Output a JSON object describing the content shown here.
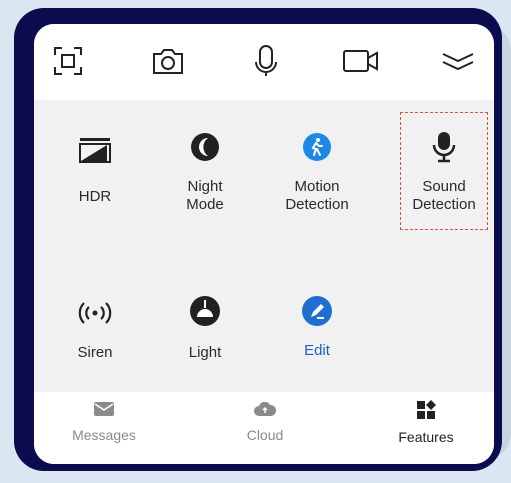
{
  "toolbar": {
    "icons": [
      "fullscreen-icon",
      "snapshot-camera-icon",
      "microphone-icon",
      "video-record-icon",
      "collapse-chevron-icon"
    ]
  },
  "features": [
    {
      "label": "HDR",
      "icon": "hdr-icon"
    },
    {
      "label": "Night\nMode",
      "icon": "night-mode-moon-icon"
    },
    {
      "label": "Motion\nDetection",
      "icon": "motion-detection-icon"
    },
    {
      "label": "Sound\nDetection",
      "icon": "sound-detection-mic-icon"
    },
    {
      "label": "Siren",
      "icon": "siren-icon"
    },
    {
      "label": "Light",
      "icon": "light-lamp-icon"
    },
    {
      "label": "Edit",
      "icon": "edit-pencil-icon"
    }
  ],
  "nav": {
    "messages": "Messages",
    "cloud": "Cloud",
    "features": "Features"
  },
  "colors": {
    "frame": "#0b0b4e",
    "accent_blue": "#1e88e5",
    "edit_text": "#1f5fbf",
    "selection_border": "#e0503f"
  }
}
